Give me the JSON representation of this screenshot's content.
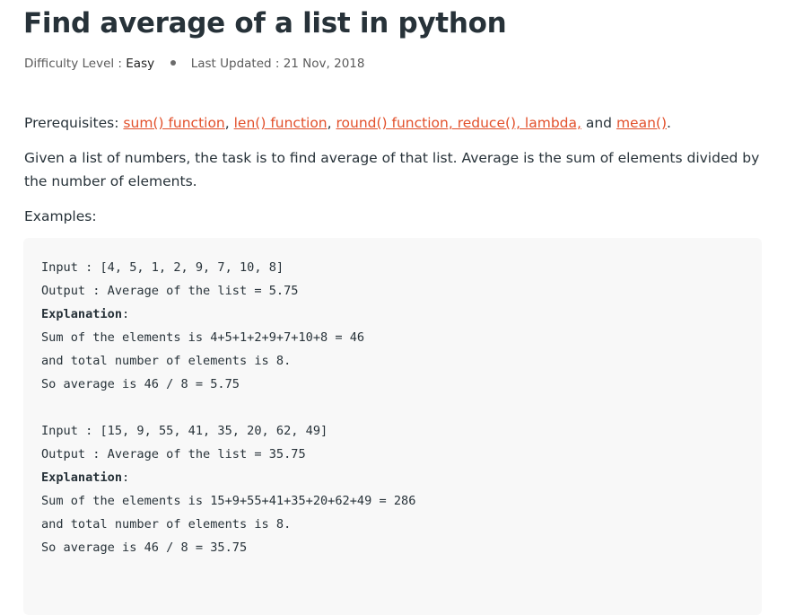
{
  "title": "Find average of a list in python",
  "meta": {
    "difficulty_label": "Difficulty Level :",
    "difficulty": "Easy",
    "updated": "Last Updated : 21 Nov, 2018"
  },
  "prereq": {
    "label": "Prerequisites:",
    "links": [
      "sum() function",
      "len() function",
      "round() function, reduce(), lambda,",
      "mean()"
    ],
    "sep1": ", ",
    "sep2": ", ",
    "and": " and ",
    "end": "."
  },
  "intro": "Given a list of numbers, the task is to find average of that list. Average is the sum of elements divided by the number of elements.",
  "examples_label": "Examples:",
  "code_lines": [
    "Input : [4, 5, 1, 2, 9, 7, 10, 8]",
    "Output : Average of the list = 5.75",
    "Explanation",
    "Sum of the elements is 4+5+1+2+9+7+10+8 = 46",
    "and total number of elements is 8.",
    "So average is 46 / 8 = 5.75",
    "",
    "Input : [15, 9, 55, 41, 35, 20, 62, 49]",
    "Output : Average of the list = 35.75",
    "Explanation",
    "Sum of the elements is 15+9+55+41+35+20+62+49 = 286",
    "and total number of elements is 8.",
    "So average is 46 / 8 = 35.75"
  ],
  "colon": ":",
  "colors": {
    "link": "#e2502b",
    "code_bg": "#f8f8f8",
    "text": "#273239"
  }
}
